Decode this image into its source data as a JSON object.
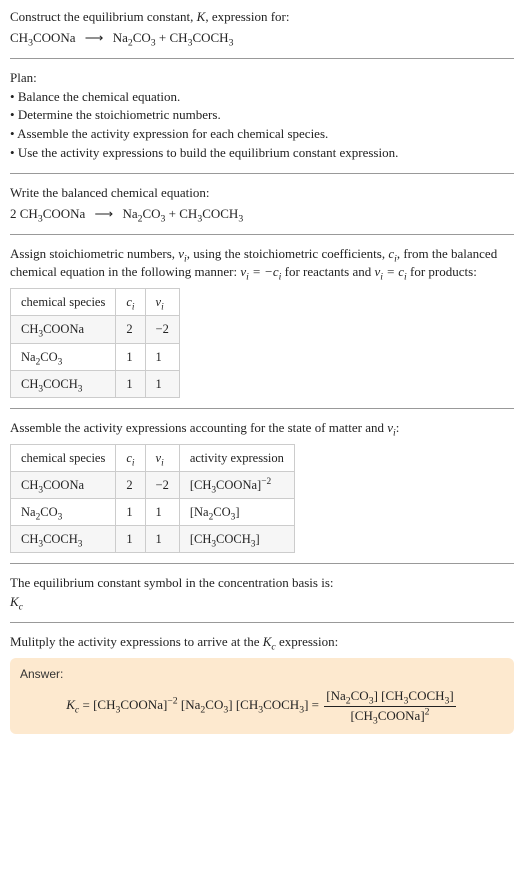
{
  "header": {
    "line1_prefix": "Construct the equilibrium constant, ",
    "line1_K": "K",
    "line1_suffix": ", expression for:"
  },
  "reaction_unbalanced": {
    "lhs": "CH₃COONa",
    "arrow": "⟶",
    "rhs_a": "Na₂CO₃",
    "plus": " + ",
    "rhs_b": "CH₃COCH₃"
  },
  "plan": {
    "title": "Plan:",
    "items": [
      "Balance the chemical equation.",
      "Determine the stoichiometric numbers.",
      "Assemble the activity expression for each chemical species.",
      "Use the activity expressions to build the equilibrium constant expression."
    ]
  },
  "balanced": {
    "intro": "Write the balanced chemical equation:",
    "coef": "2",
    "lhs": "CH₃COONa",
    "arrow": "⟶",
    "rhs_a": "Na₂CO₃",
    "plus": " + ",
    "rhs_b": "CH₃COCH₃"
  },
  "assign_text": {
    "pre": "Assign stoichiometric numbers, ",
    "nu": "ν",
    "i": "i",
    "mid1": ", using the stoichiometric coefficients, ",
    "c": "c",
    "mid2": ", from the balanced chemical equation in the following manner: ",
    "eq1_lhs": "ν",
    "eq1_rhs": " = −c",
    "react": " for reactants and ",
    "eq2": "ν",
    "eq2b": " = c",
    "prod": " for products:"
  },
  "table1": {
    "headers": [
      "chemical species",
      "cᵢ",
      "νᵢ"
    ],
    "rows": [
      [
        "CH₃COONa",
        "2",
        "−2"
      ],
      [
        "Na₂CO₃",
        "1",
        "1"
      ],
      [
        "CH₃COCH₃",
        "1",
        "1"
      ]
    ]
  },
  "assemble_text": {
    "pre": "Assemble the activity expressions accounting for the state of matter and ",
    "nu": "ν",
    "i": "i",
    "post": ":"
  },
  "table2": {
    "headers": [
      "chemical species",
      "cᵢ",
      "νᵢ",
      "activity expression"
    ],
    "rows": [
      [
        "CH₃COONa",
        "2",
        "−2",
        "[CH₃COONa]⁻²"
      ],
      [
        "Na₂CO₃",
        "1",
        "1",
        "[Na₂CO₃]"
      ],
      [
        "CH₃COCH₃",
        "1",
        "1",
        "[CH₃COCH₃]"
      ]
    ]
  },
  "basis": {
    "line": "The equilibrium constant symbol in the concentration basis is:",
    "symbol": "K",
    "sub": "c"
  },
  "multiply": {
    "line_pre": "Mulitply the activity expressions to arrive at the ",
    "Kc_K": "K",
    "Kc_c": "c",
    "line_post": " expression:"
  },
  "answer": {
    "label": "Answer:",
    "Kc_K": "K",
    "Kc_c": "c",
    "eq": " = ",
    "term1": "[CH₃COONa]",
    "exp1": "−2",
    "term2": " [Na₂CO₃] [CH₃COCH₃] = ",
    "num": "[Na₂CO₃] [CH₃COCH₃]",
    "den_base": "[CH₃COONa]",
    "den_exp": "2"
  }
}
